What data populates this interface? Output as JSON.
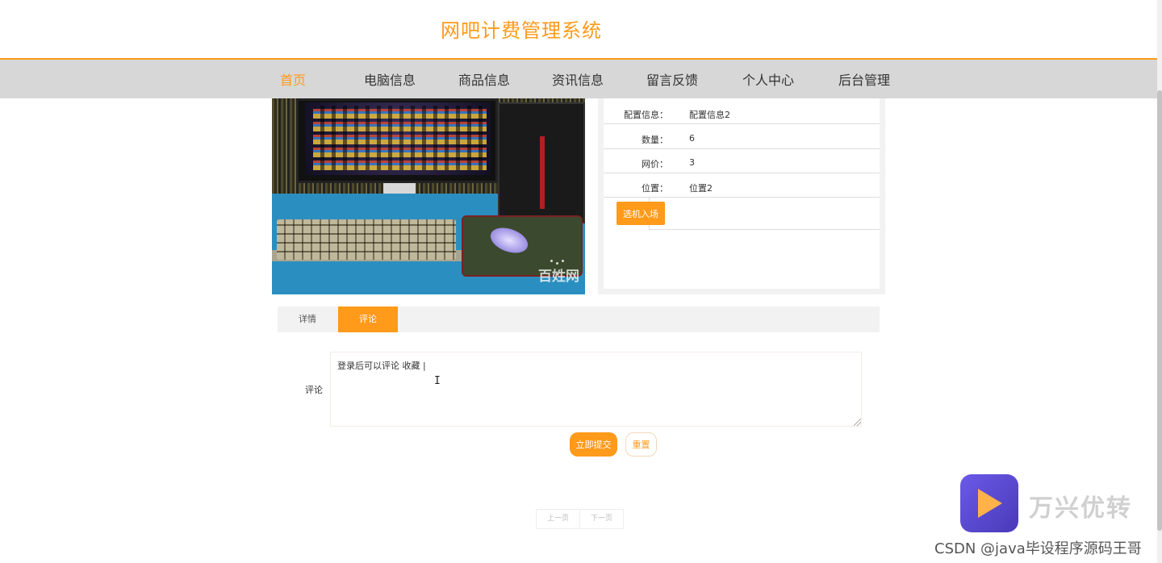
{
  "header": {
    "site_title": "网吧计费管理系统"
  },
  "nav": {
    "items": [
      {
        "label": "首页",
        "active": true
      },
      {
        "label": "电脑信息",
        "active": false
      },
      {
        "label": "商品信息",
        "active": false
      },
      {
        "label": "资讯信息",
        "active": false
      },
      {
        "label": "留言反馈",
        "active": false
      },
      {
        "label": "个人中心",
        "active": false
      },
      {
        "label": "后台管理",
        "active": false
      }
    ]
  },
  "product": {
    "image_watermark": "百姓网",
    "details": [
      {
        "label": "配置信息：",
        "value": "配置信息2"
      },
      {
        "label": "数量：",
        "value": "6"
      },
      {
        "label": "网价：",
        "value": "3"
      },
      {
        "label": "位置：",
        "value": "位置2"
      }
    ],
    "book_button": "选机入场"
  },
  "tabs": [
    {
      "label": "详情",
      "active": false
    },
    {
      "label": "评论",
      "active": true
    }
  ],
  "comment_form": {
    "label": "评论",
    "text": "登录后可以评论 收藏 |",
    "submit": "立即提交",
    "reset": "重置"
  },
  "pagination": {
    "prev": "上一页",
    "next": "下一页"
  },
  "overlay": {
    "app_name": "万兴优转",
    "credit": "CSDN @java毕设程序源码王哥"
  },
  "colors": {
    "accent": "#ff9a1a",
    "nav_bg": "#d7d7d7"
  }
}
